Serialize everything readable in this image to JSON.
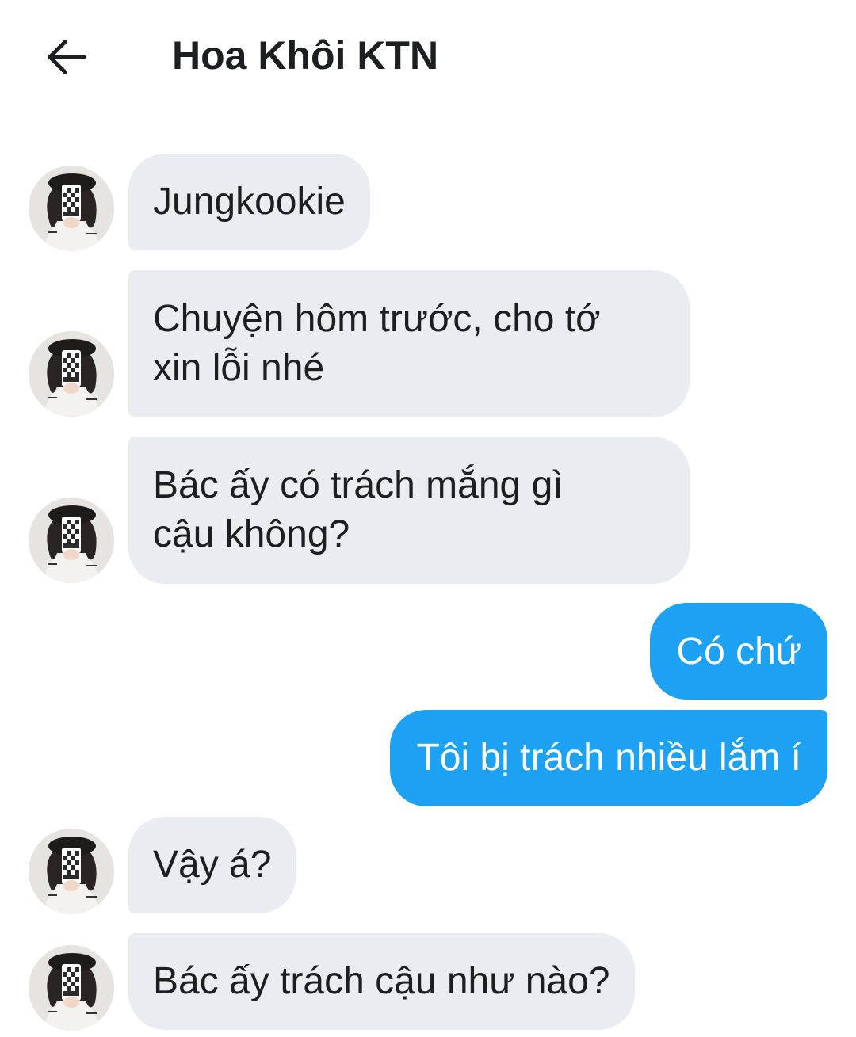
{
  "header": {
    "back_icon": "arrow-left-icon",
    "title": "Hoa Khôi KTN"
  },
  "conversation": {
    "accent_color": "#1da1f2",
    "incoming_bubble_color": "#e9ecf0",
    "messages": [
      {
        "sender": "other",
        "lines": [
          "Jungkookie"
        ]
      },
      {
        "sender": "other",
        "lines": [
          "Chuyện hôm trước, cho tớ",
          "xin lỗi nhé"
        ]
      },
      {
        "sender": "other",
        "lines": [
          "Bác ấy có trách mắng gì",
          "cậu không?"
        ]
      },
      {
        "sender": "me",
        "lines": [
          "Có chứ"
        ]
      },
      {
        "sender": "me",
        "lines": [
          "Tôi bị trách nhiều lắm í"
        ]
      },
      {
        "sender": "other",
        "lines": [
          "Vậy á?"
        ]
      },
      {
        "sender": "other",
        "lines": [
          "Bác ấy trách cậu như nào?"
        ]
      }
    ]
  }
}
